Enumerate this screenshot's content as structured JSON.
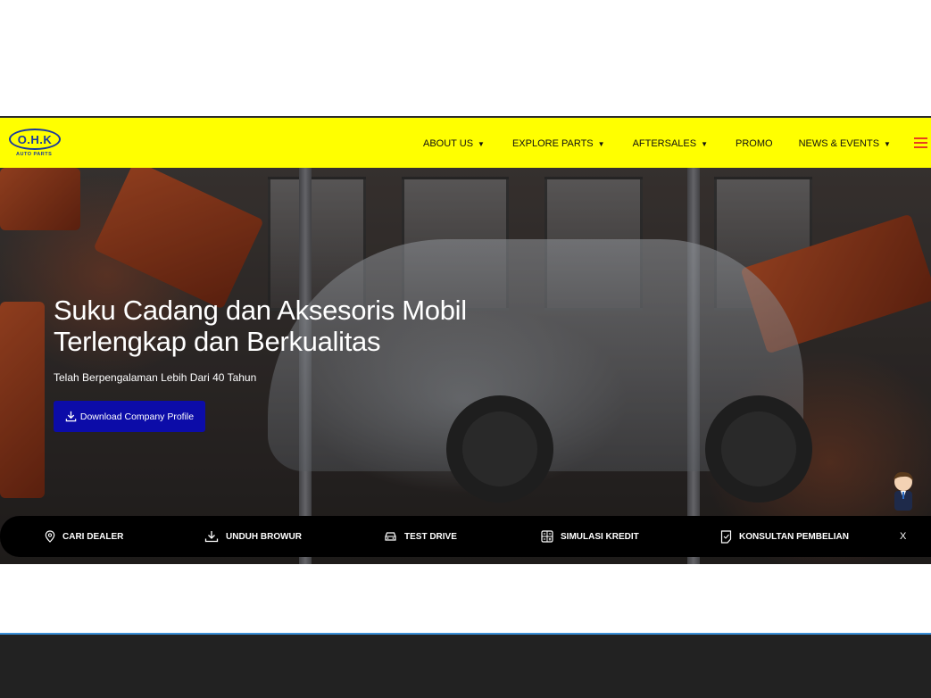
{
  "header": {
    "logo_text": "O.H.K",
    "logo_subtext": "AUTO PARTS",
    "nav": [
      {
        "label": "ABOUT US",
        "caret": "▼"
      },
      {
        "label": "EXPLORE PARTS",
        "caret": "▼"
      },
      {
        "label": "AFTERSALES",
        "caret": "▼"
      },
      {
        "label": "PROMO"
      },
      {
        "label": "NEWS & EVENTS",
        "caret": "▼"
      }
    ],
    "accent": "#ffff00",
    "menu_icon": "hamburger-icon"
  },
  "hero": {
    "title_line1": "Suku Cadang dan Aksesoris Mobil",
    "title_line2": "Terlengkap dan Berkualitas",
    "subtitle": "Telah Berpengalaman Lebih Dari 40 Tahun",
    "button_label": "Download Company Profile",
    "button_color": "#0c0ca8"
  },
  "quickbar": {
    "items": [
      {
        "label": "CARI DEALER",
        "icon": "location-pin-icon"
      },
      {
        "label": "UNDUH BROWUR",
        "icon": "download-icon"
      },
      {
        "label": "TEST DRIVE",
        "icon": "car-icon"
      },
      {
        "label": "SIMULASI KREDIT",
        "icon": "calculator-icon"
      },
      {
        "label": "KONSULTAN PEMBELIAN",
        "icon": "document-icon"
      }
    ],
    "close_label": "X"
  }
}
